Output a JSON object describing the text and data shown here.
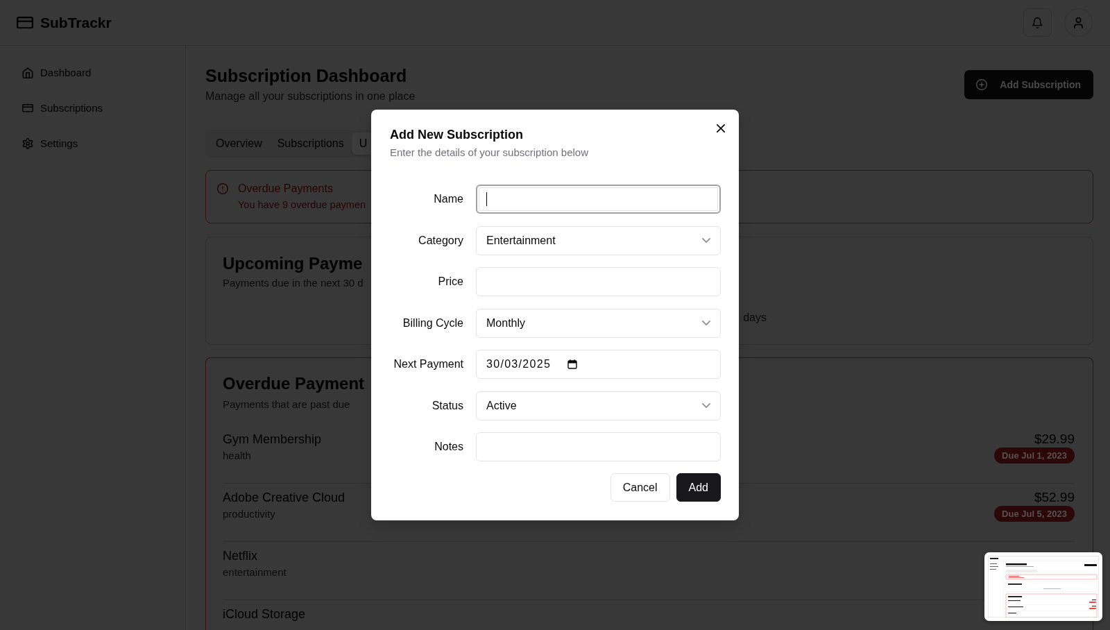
{
  "app": {
    "name": "SubTrackr"
  },
  "sidebar": {
    "items": [
      {
        "label": "Dashboard",
        "selected": false
      },
      {
        "label": "Subscriptions",
        "selected": false
      },
      {
        "label": "Settings",
        "selected": false
      }
    ]
  },
  "page": {
    "title": "Subscription Dashboard",
    "subtitle": "Manage all your subscriptions in one place",
    "add_button": "Add Subscription"
  },
  "tabs": [
    {
      "label": "Overview",
      "selected": false
    },
    {
      "label": "Subscriptions",
      "selected": false
    },
    {
      "label": "U",
      "selected": true
    }
  ],
  "alert": {
    "title": "Overdue Payments",
    "message": "You have 9 overdue paymen"
  },
  "upcoming": {
    "title": "Upcoming Payme",
    "subtitle": "Payments due in the next 30 d",
    "empty_text": "days"
  },
  "overdue": {
    "title": "Overdue Payment",
    "subtitle": "Payments that are past due",
    "rows": [
      {
        "name": "Gym Membership",
        "category": "health",
        "price": "$29.99",
        "due": "Due Jul 1, 2023"
      },
      {
        "name": "Adobe Creative Cloud",
        "category": "productivity",
        "price": "$52.99",
        "due": "Due Jul 5, 2023"
      },
      {
        "name": "Netflix",
        "category": "entertainment"
      },
      {
        "name": "iCloud Storage"
      }
    ]
  },
  "dialog": {
    "title": "Add New Subscription",
    "description": "Enter the details of your subscription below",
    "fields": [
      {
        "label": "Name",
        "kind": "text",
        "focused": true
      },
      {
        "label": "Category",
        "kind": "select",
        "value": "Entertainment",
        "focused": false
      },
      {
        "label": "Price",
        "kind": "text",
        "focused": false
      },
      {
        "label": "Billing Cycle",
        "kind": "select",
        "value": "Monthly",
        "focused": false
      },
      {
        "label": "Next Payment",
        "kind": "date",
        "value": "30/03/2025",
        "focused": false
      },
      {
        "label": "Status",
        "kind": "select",
        "value": "Active",
        "focused": false
      },
      {
        "label": "Notes",
        "kind": "text",
        "focused": false
      }
    ],
    "buttons": [
      {
        "label": "Cancel",
        "kind": "secondary"
      },
      {
        "label": "Add",
        "kind": "primary"
      }
    ]
  }
}
